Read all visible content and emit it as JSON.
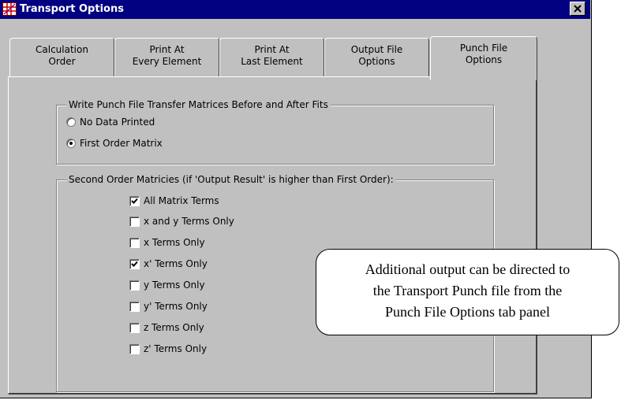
{
  "window": {
    "title": "Transport Options",
    "icon": "grid-app-icon",
    "close_icon": "close-icon"
  },
  "tabs": [
    {
      "label": "Calculation\nOrder",
      "active": false
    },
    {
      "label": "Print At\nEvery Element",
      "active": false
    },
    {
      "label": "Print At\nLast Element",
      "active": false
    },
    {
      "label": "Output File\nOptions",
      "active": false
    },
    {
      "label": "Punch File\nOptions",
      "active": true
    }
  ],
  "punch_group": {
    "label": "Write Punch File Transfer Matrices Before and After Fits",
    "options": [
      {
        "label": "No Data Printed",
        "selected": false
      },
      {
        "label": "First Order Matrix",
        "selected": true
      }
    ]
  },
  "second_order_group": {
    "label": "Second Order Matricies (if 'Output Result' is higher than First Order):",
    "options": [
      {
        "label": "All Matrix Terms",
        "checked": true
      },
      {
        "label": "x and y Terms Only",
        "checked": false
      },
      {
        "label": "x Terms Only",
        "checked": false
      },
      {
        "label": "x' Terms Only",
        "checked": true
      },
      {
        "label": "y Terms Only",
        "checked": false
      },
      {
        "label": "y' Terms Only",
        "checked": false
      },
      {
        "label": "z Terms Only",
        "checked": false
      },
      {
        "label": "z' Terms Only",
        "checked": false
      }
    ]
  },
  "callout": {
    "lines": [
      "Additional output can be directed to",
      "the Transport Punch file from the",
      "Punch File Options tab panel"
    ]
  },
  "colors": {
    "titlebar": "#000080",
    "dialog_face": "#c0c0c0"
  }
}
